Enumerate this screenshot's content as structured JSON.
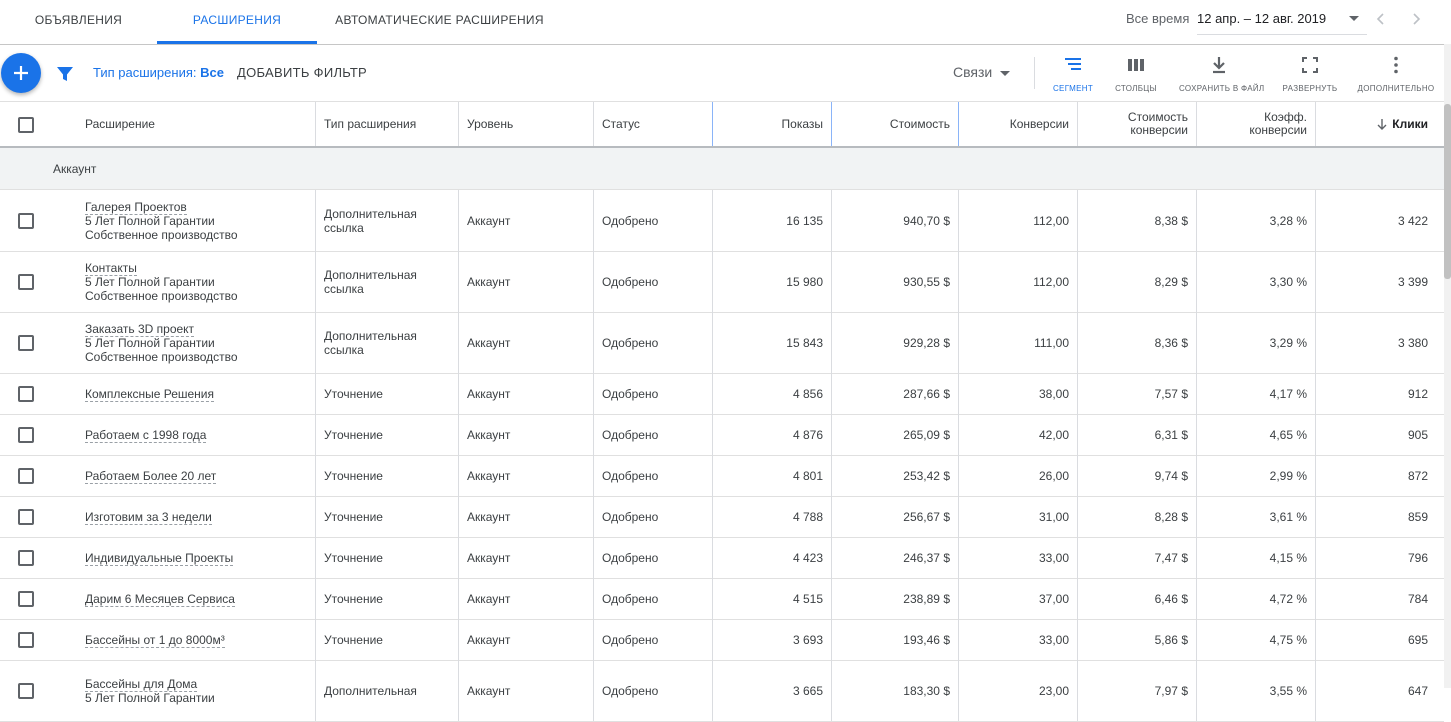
{
  "tabs": [
    {
      "label": "ОБЪЯВЛЕНИЯ"
    },
    {
      "label": "РАСШИРЕНИЯ"
    },
    {
      "label": "АВТОМАТИЧЕСКИЕ РАСШИРЕНИЯ"
    }
  ],
  "date": {
    "range_label": "Все время",
    "range_value": "12 апр. – 12 авг. 2019"
  },
  "toolbar": {
    "filter_label": "Тип расширения:",
    "filter_value": "Все",
    "add_filter": "ДОБАВИТЬ ФИЛЬТР",
    "links": "Связи",
    "segment": "СЕГМЕНТ",
    "columns": "СТОЛБЦЫ",
    "save": "СОХРАНИТЬ В ФАЙЛ",
    "expand": "РАЗВЕРНУТЬ",
    "more": "ДОПОЛНИТЕЛЬНО"
  },
  "accent_color": "#1a73e8",
  "table": {
    "headers": {
      "extension": "Расширение",
      "type": "Тип расширения",
      "level": "Уровень",
      "status": "Статус",
      "impressions": "Показы",
      "cost": "Стоимость",
      "conversions": "Конверсии",
      "cost_conv_1": "Стоимость",
      "cost_conv_2": "конверсии",
      "conv_rate_1": "Коэфф.",
      "conv_rate_2": "конверсии",
      "clicks": "Клики"
    },
    "group_label": "Аккаунт",
    "rows": [
      {
        "name": "Галерея Проектов",
        "desc1": "5 Лет Полной Гарантии",
        "desc2": "Собственное производство",
        "type1": "Дополнительная",
        "type2": "ссылка",
        "level": "Аккаунт",
        "status": "Одобрено",
        "impressions": "16 135",
        "cost": "940,70 $",
        "conversions": "112,00",
        "cost_conv": "8,38 $",
        "conv_rate": "3,28 %",
        "clicks": "3 422"
      },
      {
        "name": "Контакты",
        "desc1": "5 Лет Полной Гарантии",
        "desc2": "Собственное производство",
        "type1": "Дополнительная",
        "type2": "ссылка",
        "level": "Аккаунт",
        "status": "Одобрено",
        "impressions": "15 980",
        "cost": "930,55 $",
        "conversions": "112,00",
        "cost_conv": "8,29 $",
        "conv_rate": "3,30 %",
        "clicks": "3 399"
      },
      {
        "name": "Заказать 3D проект",
        "desc1": "5 Лет Полной Гарантии",
        "desc2": "Собственное производство",
        "type1": "Дополнительная",
        "type2": "ссылка",
        "level": "Аккаунт",
        "status": "Одобрено",
        "impressions": "15 843",
        "cost": "929,28 $",
        "conversions": "111,00",
        "cost_conv": "8,36 $",
        "conv_rate": "3,29 %",
        "clicks": "3 380"
      },
      {
        "name": "Комплексные Решения",
        "type1": "Уточнение",
        "level": "Аккаунт",
        "status": "Одобрено",
        "impressions": "4 856",
        "cost": "287,66 $",
        "conversions": "38,00",
        "cost_conv": "7,57 $",
        "conv_rate": "4,17 %",
        "clicks": "912"
      },
      {
        "name": "Работаем с 1998 года",
        "type1": "Уточнение",
        "level": "Аккаунт",
        "status": "Одобрено",
        "impressions": "4 876",
        "cost": "265,09 $",
        "conversions": "42,00",
        "cost_conv": "6,31 $",
        "conv_rate": "4,65 %",
        "clicks": "905"
      },
      {
        "name": "Работаем Более 20 лет",
        "type1": "Уточнение",
        "level": "Аккаунт",
        "status": "Одобрено",
        "impressions": "4 801",
        "cost": "253,42 $",
        "conversions": "26,00",
        "cost_conv": "9,74 $",
        "conv_rate": "2,99 %",
        "clicks": "872"
      },
      {
        "name": "Изготовим за 3 недели",
        "type1": "Уточнение",
        "level": "Аккаунт",
        "status": "Одобрено",
        "impressions": "4 788",
        "cost": "256,67 $",
        "conversions": "31,00",
        "cost_conv": "8,28 $",
        "conv_rate": "3,61 %",
        "clicks": "859"
      },
      {
        "name": "Индивидуальные Проекты",
        "type1": "Уточнение",
        "level": "Аккаунт",
        "status": "Одобрено",
        "impressions": "4 423",
        "cost": "246,37 $",
        "conversions": "33,00",
        "cost_conv": "7,47 $",
        "conv_rate": "4,15 %",
        "clicks": "796"
      },
      {
        "name": "Дарим 6 Месяцев Сервиса",
        "type1": "Уточнение",
        "level": "Аккаунт",
        "status": "Одобрено",
        "impressions": "4 515",
        "cost": "238,89 $",
        "conversions": "37,00",
        "cost_conv": "6,46 $",
        "conv_rate": "4,72 %",
        "clicks": "784"
      },
      {
        "name": "Бассейны от 1 до 8000м³",
        "type1": "Уточнение",
        "level": "Аккаунт",
        "status": "Одобрено",
        "impressions": "3 693",
        "cost": "193,46 $",
        "conversions": "33,00",
        "cost_conv": "5,86 $",
        "conv_rate": "4,75 %",
        "clicks": "695"
      },
      {
        "name": "Бассейны для Дома",
        "desc1": "5 Лет Полной Гарантии",
        "desc2": "",
        "type1": "Дополнительная",
        "type2": "",
        "level": "Аккаунт",
        "status": "Одобрено",
        "impressions": "3 665",
        "cost": "183,30 $",
        "conversions": "23,00",
        "cost_conv": "7,97 $",
        "conv_rate": "3,55 %",
        "clicks": "647"
      }
    ]
  }
}
